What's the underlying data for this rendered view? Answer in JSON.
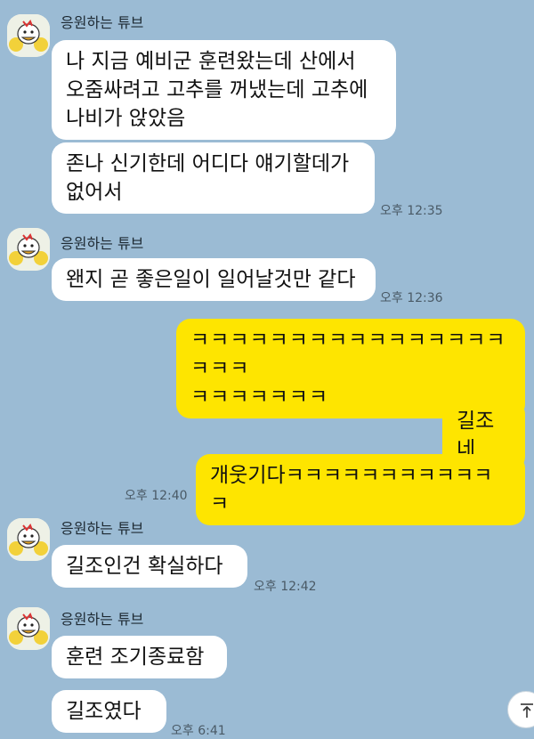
{
  "chat": {
    "messages": [
      {
        "sender": "응원하는 튜브",
        "texts": [
          "나 지금 예비군 훈련왔는데 산에서\n오줌싸려고 고추를 꺼냈는데 고추에\n나비가 앉았음",
          "존나 신기한데 어디다 얘기할데가\n없어서"
        ],
        "time": "오후 12:35"
      },
      {
        "sender": "응원하는 튜브",
        "texts": [
          "왠지 곧 좋은일이 일어날것만 같다"
        ],
        "time": "오후 12:36"
      },
      {
        "sender": "me",
        "texts": [
          "ㅋㅋㅋㅋㅋㅋㅋㅋㅋㅋㅋㅋㅋㅋㅋㅋㅋㅋㅋ\nㅋㅋㅋㅋㅋㅋㅋ",
          "길조네",
          "개웃기다ㅋㅋㅋㅋㅋㅋㅋㅋㅋㅋㅋㅋ"
        ],
        "time": "오후 12:40"
      },
      {
        "sender": "응원하는 튜브",
        "texts": [
          "길조인건 확실하다"
        ],
        "time": "오후 12:42"
      },
      {
        "sender": "응원하는 튜브",
        "texts": [
          "훈련 조기종료함",
          "길조였다"
        ],
        "time": "오후 6:41"
      }
    ]
  },
  "colors": {
    "background": "#9bbbd4",
    "my_bubble": "#fee500",
    "their_bubble": "#ffffff"
  },
  "icons": {
    "avatar": "tube-duck-avatar-icon",
    "scroll_bottom": "arrow-to-bottom-icon"
  }
}
